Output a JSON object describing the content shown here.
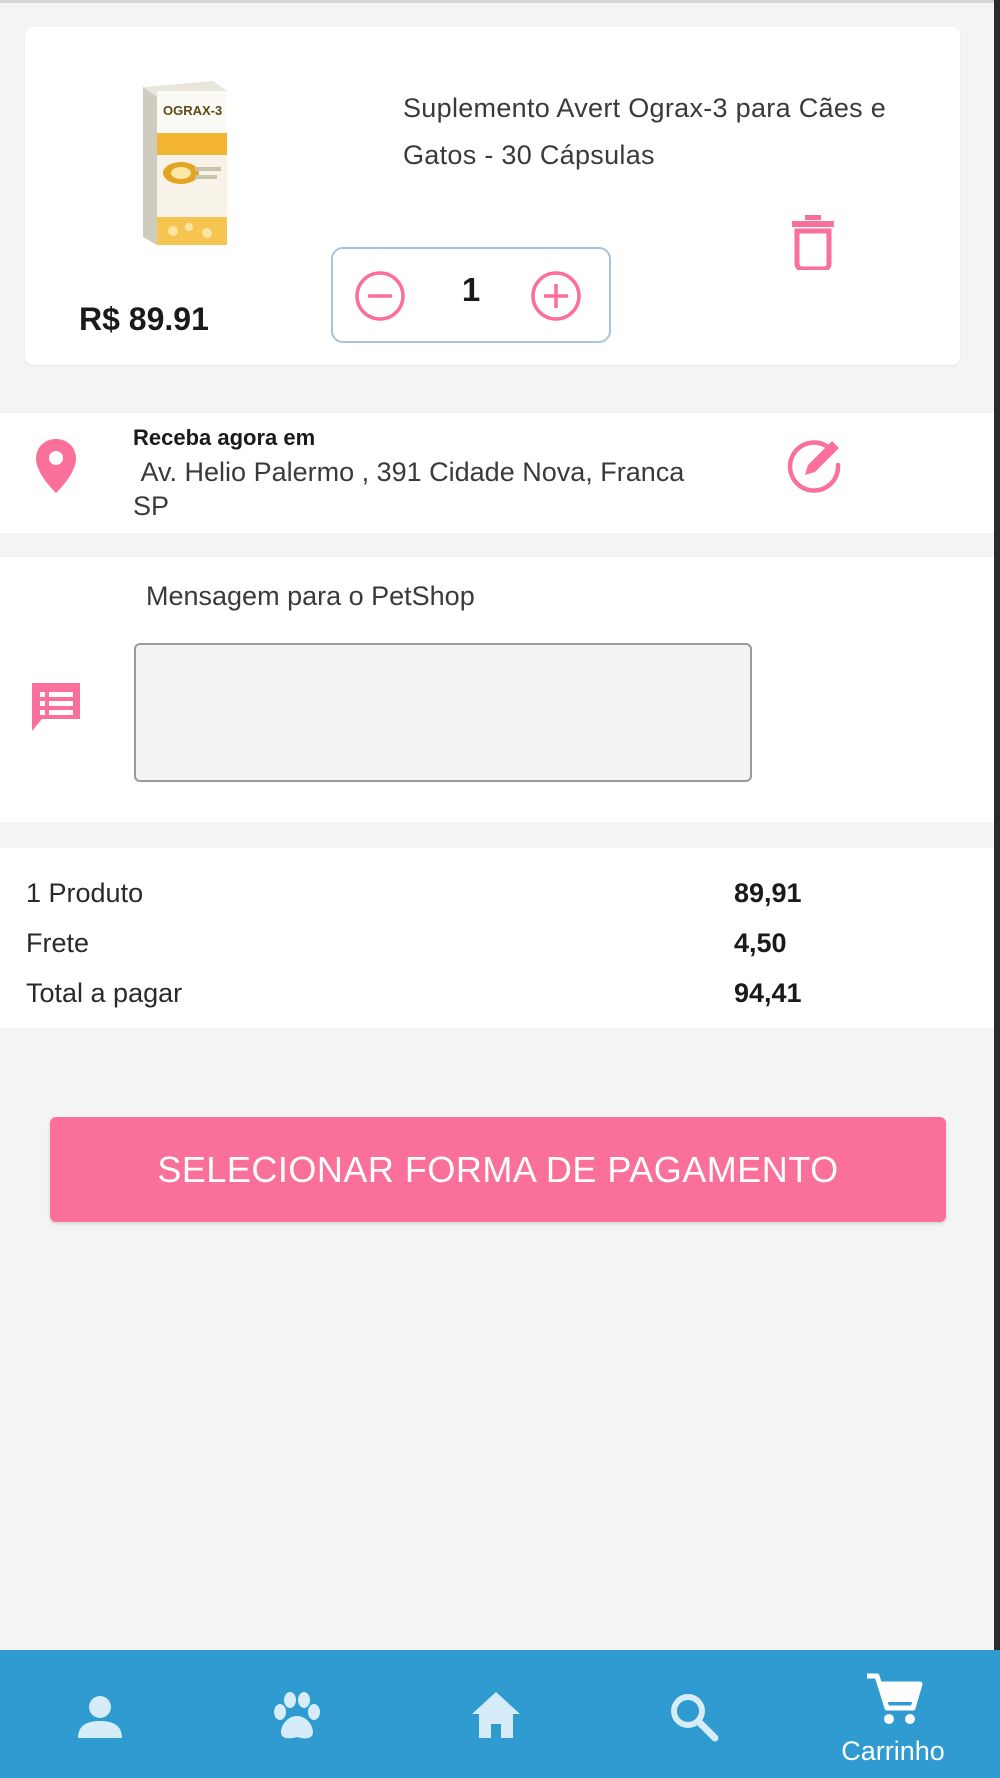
{
  "colors": {
    "accent": "#fb6f9b",
    "nav_background": "#2f9bd0",
    "nav_icon": "#d6ecf8",
    "stepper_border": "#a9c2de"
  },
  "cart_item": {
    "image_icon": "product-box-image",
    "title": "Suplemento Avert Ograx-3 para Cães e Gatos - 30 Cápsulas",
    "price": "R$ 89.91",
    "quantity": "1",
    "minus_icon": "minus-circle-icon",
    "plus_icon": "plus-circle-icon",
    "delete_icon": "trash-icon"
  },
  "address": {
    "icon": "location-pin-icon",
    "label": "Receba agora em",
    "text": " Av. Helio Palermo , 391 Cidade Nova, Franca\nSP",
    "edit_icon": "edit-pencil-icon"
  },
  "message": {
    "icon": "message-icon",
    "label": "Mensagem para o PetShop",
    "value": ""
  },
  "summary": [
    {
      "label": " 1 Produto",
      "value": "89,91"
    },
    {
      "label": "Frete",
      "value": "4,50"
    },
    {
      "label": "Total a pagar",
      "value": "94,41"
    }
  ],
  "pay_button": {
    "label": "SELECIONAR FORMA DE PAGAMENTO"
  },
  "bottom_nav": {
    "items": [
      {
        "icon": "person-icon",
        "label": ""
      },
      {
        "icon": "paw-icon",
        "label": ""
      },
      {
        "icon": "home-icon",
        "label": ""
      },
      {
        "icon": "search-icon",
        "label": ""
      },
      {
        "icon": "cart-icon",
        "label": "Carrinho"
      }
    ]
  }
}
